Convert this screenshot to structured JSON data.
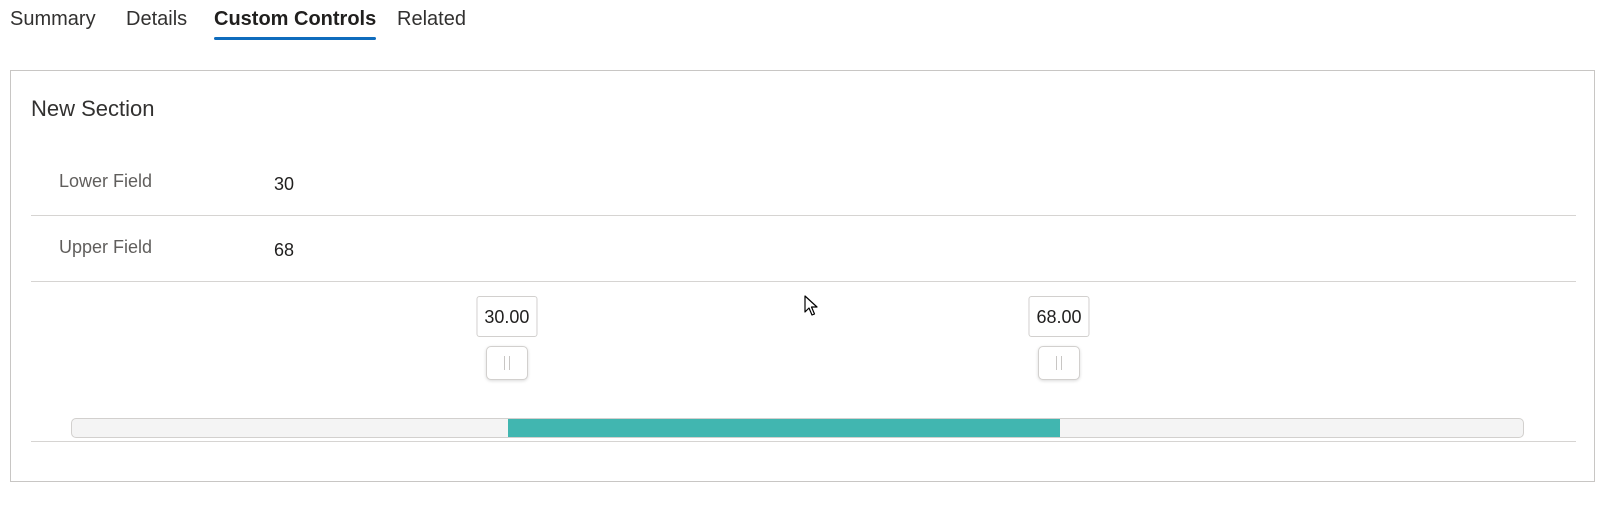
{
  "tabs": [
    {
      "label": "Summary",
      "active": false
    },
    {
      "label": "Details",
      "active": false
    },
    {
      "label": "Custom Controls",
      "active": true
    },
    {
      "label": "Related",
      "active": false
    }
  ],
  "section": {
    "title": "New Section",
    "fields": [
      {
        "label": "Lower Field",
        "value": "30"
      },
      {
        "label": "Upper Field",
        "value": "68"
      }
    ]
  },
  "range_slider": {
    "min": 0,
    "max": 100,
    "lower_value": 30,
    "upper_value": 68,
    "lower_label": "30.00",
    "upper_label": "68.00",
    "fill_color": "#41b6b0"
  },
  "colors": {
    "accent": "#0f6cbd",
    "slider_fill": "#41b6b0"
  }
}
